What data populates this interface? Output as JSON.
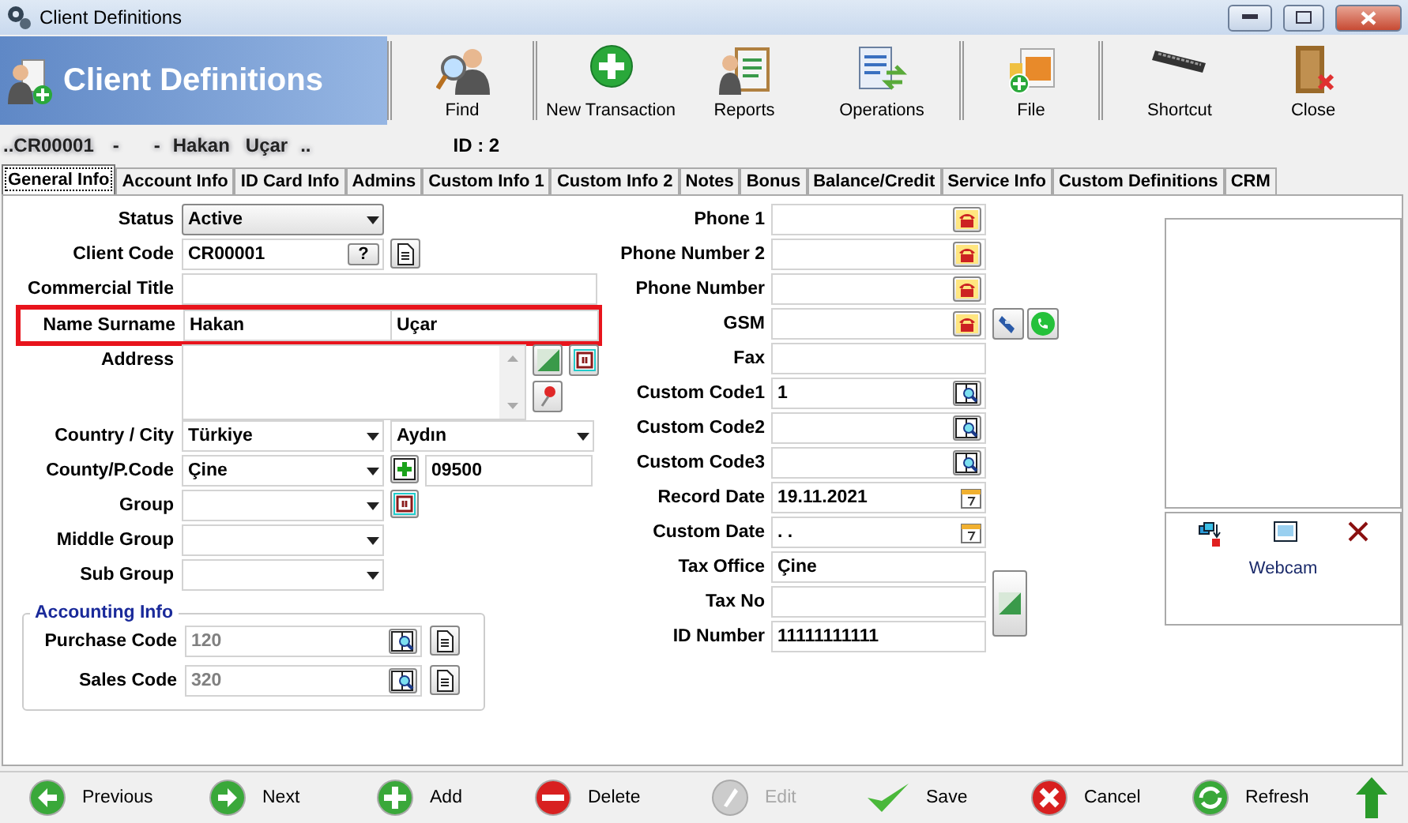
{
  "window": {
    "title": "Client Definitions"
  },
  "header": {
    "title": "Client Definitions"
  },
  "toolbar": [
    {
      "label": "Find",
      "kind": "find",
      "separator_before": true
    },
    {
      "label": "New Transaction",
      "kind": "new",
      "separator_before": true
    },
    {
      "label": "Reports",
      "kind": "reports",
      "separator_before": false
    },
    {
      "label": "Operations",
      "kind": "operations",
      "separator_before": false
    },
    {
      "label": "File",
      "kind": "file",
      "separator_before": true
    },
    {
      "label": "Shortcut",
      "kind": "shortcut",
      "separator_before": true
    },
    {
      "label": "Close",
      "kind": "close",
      "separator_before": false
    }
  ],
  "record_line": {
    "prefix": "..",
    "code": "CR00001",
    "dash_1": "-",
    "dash_2": "-",
    "name": "Hakan",
    "surname": "Uçar",
    "suffix": "..",
    "id": "ID : 2"
  },
  "tabs": [
    {
      "label": "General Info",
      "selected": true
    },
    {
      "label": "Account Info",
      "selected": false
    },
    {
      "label": "ID Card Info",
      "selected": false
    },
    {
      "label": "Admins",
      "selected": false
    },
    {
      "label": "Custom Info 1",
      "selected": false
    },
    {
      "label": "Custom Info 2",
      "selected": false
    },
    {
      "label": "Notes",
      "selected": false
    },
    {
      "label": "Bonus",
      "selected": false
    },
    {
      "label": "Balance/Credit",
      "selected": false
    },
    {
      "label": "Service Info",
      "selected": false
    },
    {
      "label": "Custom Definitions",
      "selected": false
    },
    {
      "label": "CRM",
      "selected": false
    }
  ],
  "left_form": [
    {
      "label": "Status",
      "kind": "select",
      "value": "Active",
      "highlighted": false
    },
    {
      "label": "Client Code",
      "kind": "code",
      "value": "CR00001",
      "button": "?",
      "highlighted": false
    },
    {
      "label": "Commercial Title",
      "kind": "text",
      "highlighted": false
    },
    {
      "label": "Name Surname",
      "kind": "pair",
      "values": [
        "Hakan",
        "Uçar"
      ],
      "highlighted": true
    },
    {
      "label": "Address",
      "kind": "memo",
      "highlighted": false
    },
    {
      "label": "Country / City",
      "kind": "select_pair",
      "values": [
        "Türkiye",
        "Aydın"
      ],
      "highlighted": false
    },
    {
      "label": "County/P.Code",
      "kind": "select_add",
      "value": "Çine",
      "extra": "09500",
      "highlighted": false
    },
    {
      "label": "Group",
      "kind": "select_action",
      "highlighted": false
    },
    {
      "label": "Middle Group",
      "kind": "select",
      "highlighted": false
    },
    {
      "label": "Sub Group",
      "kind": "select",
      "highlighted": false
    }
  ],
  "accounting": {
    "title": "Accounting Info",
    "fields": [
      {
        "label": "Purchase Code",
        "value": "120",
        "disabled": true
      },
      {
        "label": "Sales Code",
        "value": "320",
        "disabled": true
      }
    ]
  },
  "right_form": [
    {
      "label": "Phone 1",
      "kind": "phone"
    },
    {
      "label": "Phone Number 2",
      "kind": "phone"
    },
    {
      "label": "Phone Number",
      "kind": "phone"
    },
    {
      "label": "GSM",
      "kind": "mobile"
    },
    {
      "label": "Fax",
      "kind": "text"
    },
    {
      "label": "Custom Code1",
      "kind": "lookup",
      "value": "1"
    },
    {
      "label": "Custom Code2",
      "kind": "lookup"
    },
    {
      "label": "Custom Code3",
      "kind": "lookup"
    },
    {
      "label": "Record Date",
      "kind": "date",
      "value": "19.11.2021"
    },
    {
      "label": "Custom Date",
      "kind": "date",
      "value": ". ."
    },
    {
      "label": "Tax Office",
      "kind": "text",
      "value": "Çine"
    },
    {
      "label": "Tax No",
      "kind": "text_side"
    },
    {
      "label": "ID Number",
      "kind": "text",
      "value": "11111111111"
    }
  ],
  "webcam": {
    "label": "Webcam"
  },
  "bottom_bar": [
    {
      "label": "Previous",
      "kind": "previous",
      "disabled": false
    },
    {
      "label": "Next",
      "kind": "next",
      "disabled": false
    },
    {
      "label": "Add",
      "kind": "add",
      "disabled": false
    },
    {
      "label": "Delete",
      "kind": "delete",
      "disabled": false
    },
    {
      "label": "Edit",
      "kind": "edit",
      "disabled": true
    },
    {
      "label": "Save",
      "kind": "save",
      "disabled": false
    },
    {
      "label": "Cancel",
      "kind": "cancel",
      "disabled": false
    },
    {
      "label": "Refresh",
      "kind": "refresh",
      "disabled": false
    },
    {
      "kind": "up",
      "disabled": false
    }
  ]
}
